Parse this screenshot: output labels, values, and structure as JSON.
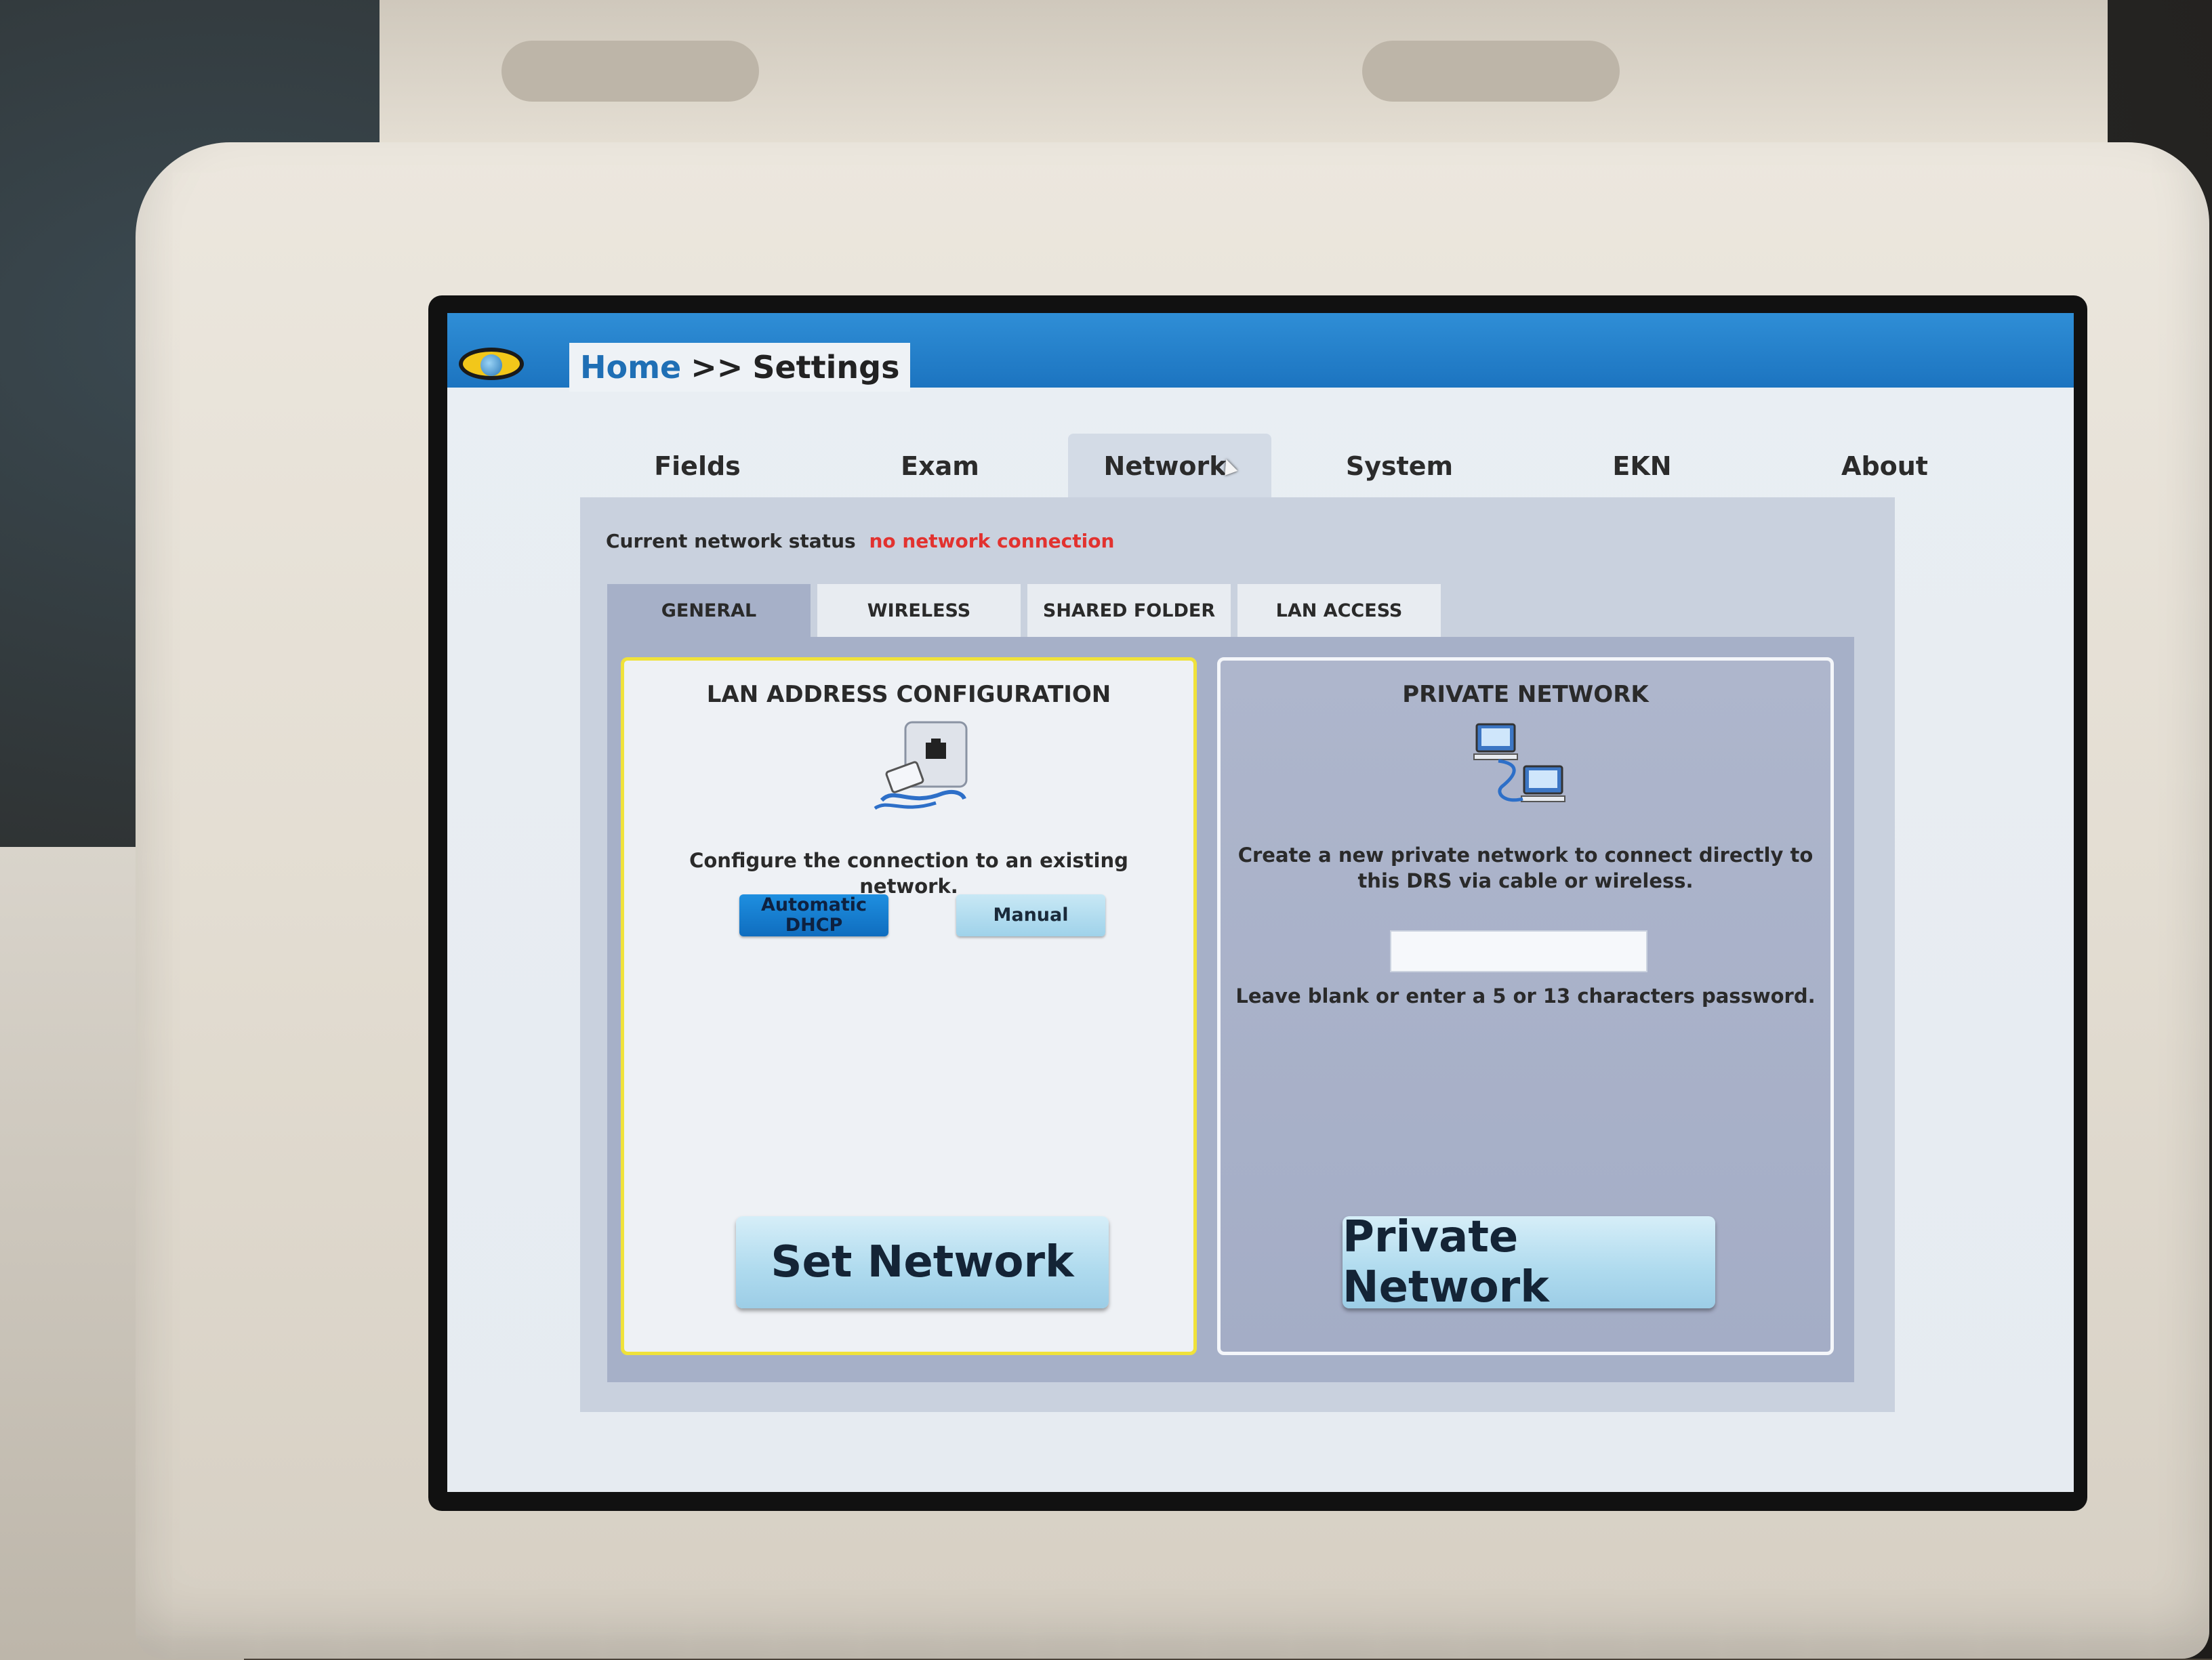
{
  "breadcrumb": {
    "home": "Home",
    "separator": ">>",
    "current": "Settings"
  },
  "main_tabs": [
    {
      "label": "Fields"
    },
    {
      "label": "Exam"
    },
    {
      "label": "Network",
      "active": true
    },
    {
      "label": "System"
    },
    {
      "label": "EKN"
    },
    {
      "label": "About"
    }
  ],
  "status": {
    "label": "Current network status",
    "value": "no network connection",
    "value_color": "#e2322f"
  },
  "sub_tabs": [
    {
      "label": "GENERAL",
      "active": true
    },
    {
      "label": "WIRELESS"
    },
    {
      "label": "SHARED FOLDER"
    },
    {
      "label": "LAN ACCESS"
    }
  ],
  "lan_card": {
    "title": "LAN ADDRESS CONFIGURATION",
    "description": "Configure the connection to an existing network.",
    "dhcp_button": "Automatic DHCP",
    "manual_button": "Manual",
    "action_button": "Set Network",
    "icon": "ethernet-cable-icon"
  },
  "private_card": {
    "title": "PRIVATE NETWORK",
    "description": "Create a new private network to connect directly to this DRS via cable or wireless.",
    "password_value": "",
    "password_hint": "Leave blank or enter a 5 or 13 characters password.",
    "action_button": "Private Network",
    "icon": "networked-computers-icon"
  },
  "colors": {
    "topbar": "#1c74c0",
    "highlight_border": "#f0e23a",
    "dhcp_selected": "#1e8fe0"
  }
}
